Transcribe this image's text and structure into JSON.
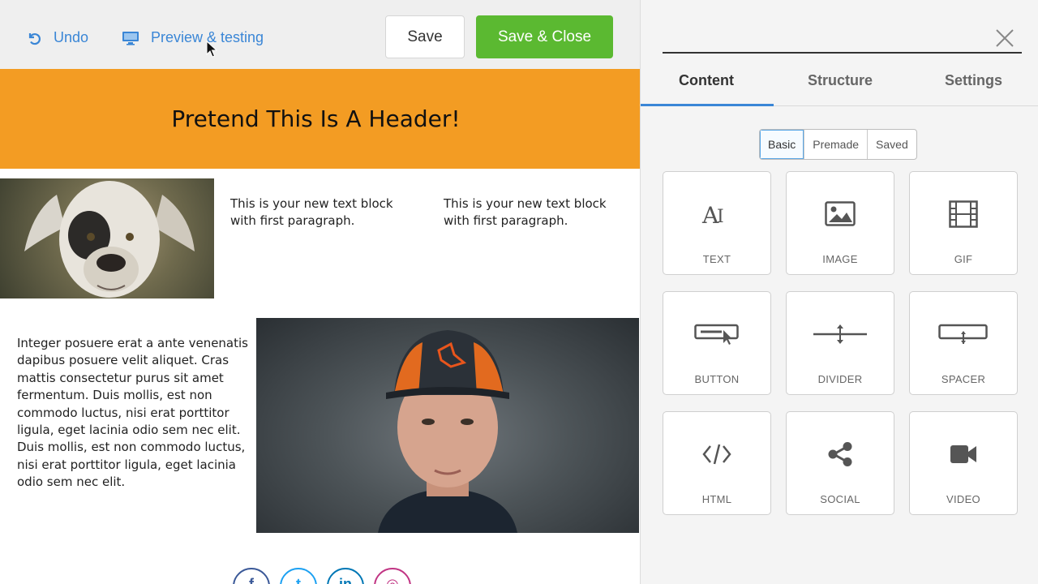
{
  "toolbar": {
    "undo_label": "Undo",
    "preview_label": "Preview & testing",
    "save_label": "Save",
    "save_close_label": "Save & Close"
  },
  "email": {
    "header_title": "Pretend This Is A Header!",
    "text_block_1": "This is your new text block with first paragraph.",
    "text_block_2": "This is your new text block with first paragraph.",
    "paragraph": "Integer posuere erat a ante venenatis dapibus posuere velit aliquet. Cras mattis consectetur purus sit amet fermentum. Duis mollis, est non commodo luctus, nisi erat porttitor ligula, eget lacinia odio sem nec elit. Duis mollis, est non commodo luctus, nisi erat porttitor ligula, eget lacinia odio sem nec elit.",
    "social_icons": [
      "facebook-icon",
      "twitter-icon",
      "linkedin-icon",
      "instagram-icon"
    ],
    "social_glyphs": [
      "f",
      "t",
      "in",
      "◎"
    ]
  },
  "panel": {
    "tabs": [
      {
        "label": "Content",
        "active": true
      },
      {
        "label": "Structure",
        "active": false
      },
      {
        "label": "Settings",
        "active": false
      }
    ],
    "segments": [
      {
        "label": "Basic",
        "active": true
      },
      {
        "label": "Premade",
        "active": false
      },
      {
        "label": "Saved",
        "active": false
      }
    ],
    "blocks": [
      {
        "label": "TEXT",
        "icon": "text-icon"
      },
      {
        "label": "IMAGE",
        "icon": "image-icon"
      },
      {
        "label": "GIF",
        "icon": "gif-film-icon"
      },
      {
        "label": "BUTTON",
        "icon": "button-icon"
      },
      {
        "label": "DIVIDER",
        "icon": "divider-icon"
      },
      {
        "label": "SPACER",
        "icon": "spacer-icon"
      },
      {
        "label": "HTML",
        "icon": "code-icon"
      },
      {
        "label": "SOCIAL",
        "icon": "share-icon"
      },
      {
        "label": "VIDEO",
        "icon": "video-camera-icon"
      }
    ]
  },
  "colors": {
    "accent_blue": "#3a86d6",
    "save_green": "#5bb931",
    "header_orange": "#f39c23",
    "facebook": "#3b5998",
    "twitter": "#1da1f2",
    "linkedin": "#0077b5",
    "instagram": "#c13584"
  }
}
